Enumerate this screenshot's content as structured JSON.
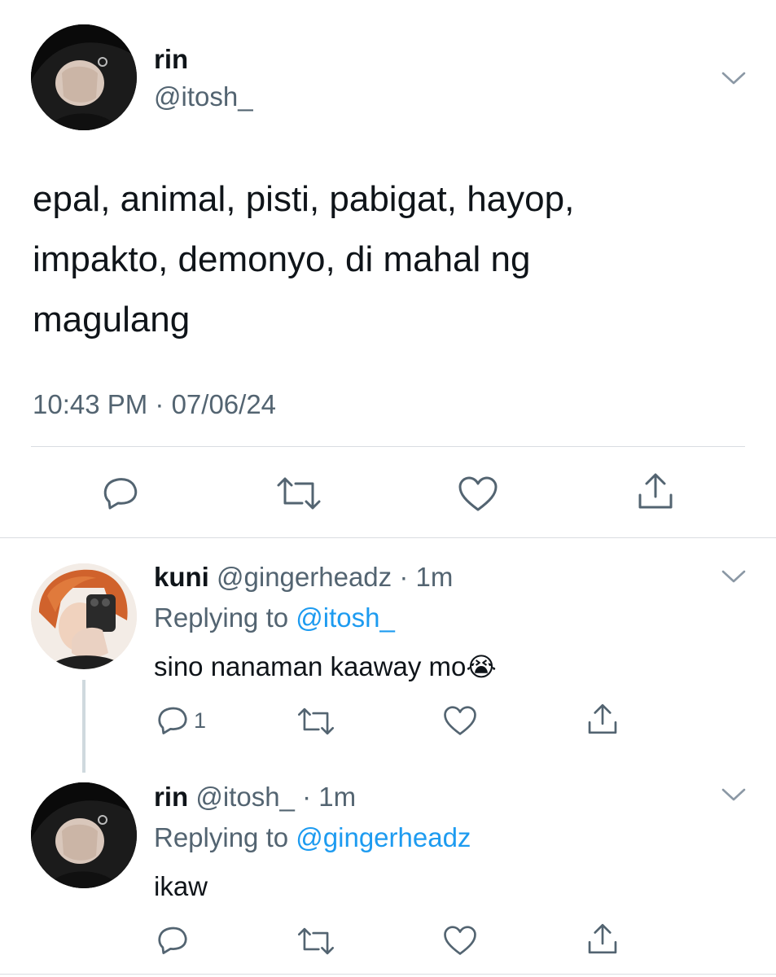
{
  "main_tweet": {
    "display_name": "rin",
    "handle": "@itosh_",
    "text_lines": [
      "epal, animal, pisti, pabigat, hayop,",
      "impakto, demonyo, di mahal ng",
      "magulang"
    ],
    "timestamp": "10:43 PM · 07/06/24",
    "actions": [
      "reply-icon",
      "retweet-icon",
      "like-icon",
      "share-icon"
    ]
  },
  "replies": [
    {
      "display_name": "kuni",
      "handle": "@gingerheadz",
      "time": "· 1m",
      "replying_label": "Replying to",
      "replying_to": "@itosh_",
      "text": "sino nanaman kaaway mo",
      "emoji": "😭",
      "reply_count": "1"
    },
    {
      "display_name": "rin",
      "handle": "@itosh_",
      "time": "· 1m",
      "replying_label": "Replying to",
      "replying_to": "@gingerheadz",
      "text": "ikaw"
    }
  ],
  "colors": {
    "text": "#0f1419",
    "muted": "#536471",
    "link": "#1d9bf0",
    "divider": "#d9dde1",
    "thread_line": "#cfd9de"
  }
}
